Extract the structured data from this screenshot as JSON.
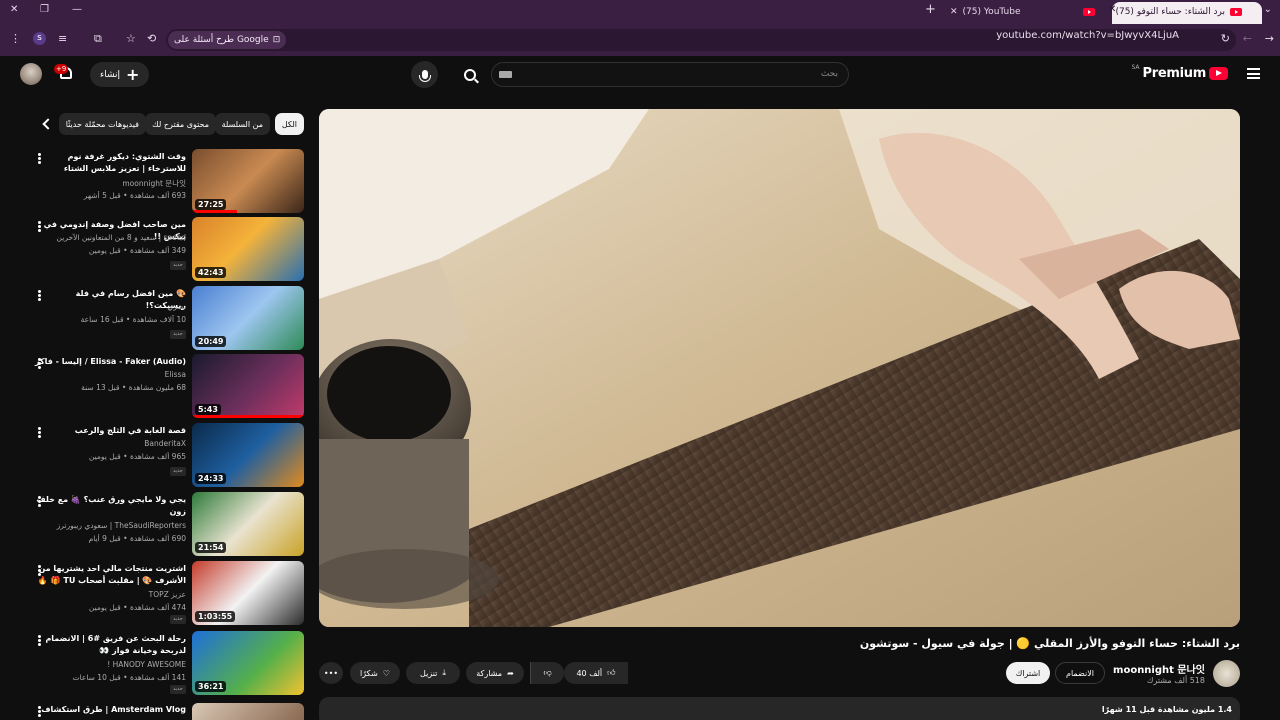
{
  "browser": {
    "tabs": [
      {
        "label": "(75) برد الشتاء: حساء التوفو",
        "active": true
      },
      {
        "label": "(75) YouTube",
        "active": false
      }
    ],
    "url": "youtube.com/watch?v=bJwyvX4LjuA",
    "google_chip": "طرح أسئلة على Google"
  },
  "header": {
    "logo_text": "Premium",
    "country_code": "SA",
    "search_placeholder": "بحث",
    "create_label": "إنشاء",
    "notification_count": "+9"
  },
  "video": {
    "title": "برد الشتاء: حساء التوفو والأرز المقلي 🟡 | جولة في سيول - سوتشون",
    "channel_name": "moonnight 문나잇",
    "subscribers": "518 ألف مشترك",
    "join_label": "الانضمام",
    "subscribe_label": "اشتراك",
    "likes": "40 ألف",
    "share_label": "مشاركة",
    "download_label": "تنزيل",
    "thanks_label": "شكرًا",
    "description_meta": "1.4 مليون مشاهدة قبل 11 شهرًا"
  },
  "chips": [
    {
      "label": "الكل",
      "active": true
    },
    {
      "label": "من السلسلة",
      "active": false
    },
    {
      "label": "محتوى مقترح لك",
      "active": false
    },
    {
      "label": "فيديوهات محمّلة حديثًا",
      "active": false
    }
  ],
  "recommendations": [
    {
      "title": "وقت الشتوي: ديكور غرفة نوم للاسترخاء | تعزيز ملابس الشتاء ومكائن السقف (with...",
      "channel": "moonnight 문나잇",
      "meta": "693 ألف مشاهدة • قبل 5 أشهر",
      "duration": "27:25",
      "badge": ""
    },
    {
      "title": "مين صاحب افضل وصفة إندومي في بيكس !!",
      "channel": "saeed | سعيد و 8 من المتعاونين الآخرين",
      "meta": "349 ألف مشاهدة • قبل يومين",
      "duration": "42:43",
      "badge": "جديد"
    },
    {
      "title": "🎨 مين افضل رسام في فلة ريسيكت؟!",
      "channel": "نصري",
      "meta": "10 آلاف مشاهدة • قبل 16 ساعة",
      "duration": "20:49",
      "badge": "جديد"
    },
    {
      "title": "Elissa - Faker (Audio) / إليسا - فاكر",
      "channel": "Elissa",
      "meta": "68 مليون مشاهدة • قبل 13 سنة",
      "duration": "5:43",
      "badge": ""
    },
    {
      "title": "قصة الغابة في الثلج والرعب",
      "channel": "BanderitaX",
      "meta": "965 ألف مشاهدة • قبل يومين",
      "duration": "24:33",
      "badge": "جديد"
    },
    {
      "title": "يجي ولا مايجي ورق عنب؟ 🍇 مع خلف زون",
      "channel": "TheSaudiReporters | سعودي ريبورترز",
      "meta": "690 ألف مشاهدة • قبل 9 أيام",
      "duration": "21:54",
      "badge": ""
    },
    {
      "title": "اشتريت منتجات مالي احد يشتريها من الأشرف 🎨 | مقلبت أصحاب TU 🎁 🔥",
      "channel": "عزيز TOPZ",
      "meta": "474 ألف مشاهدة • قبل يومين",
      "duration": "1:03:55",
      "badge": "جديد"
    },
    {
      "title": "رحلة البحث عن فريق #6 | الانضمام لدربحة وخيانة فواز 👀",
      "channel": "HANODY AWESOME !",
      "meta": "141 ألف مشاهدة • قبل 10 ساعات",
      "duration": "36:21",
      "badge": "جديد"
    },
    {
      "title": "Amsterdam Vlog | طرق استكشاف",
      "channel": "",
      "meta": "",
      "duration": "",
      "badge": ""
    }
  ],
  "colors": {
    "browser_chrome": "#3a1f43",
    "background": "#0f0f0f",
    "youtube_red": "#ff0033"
  }
}
